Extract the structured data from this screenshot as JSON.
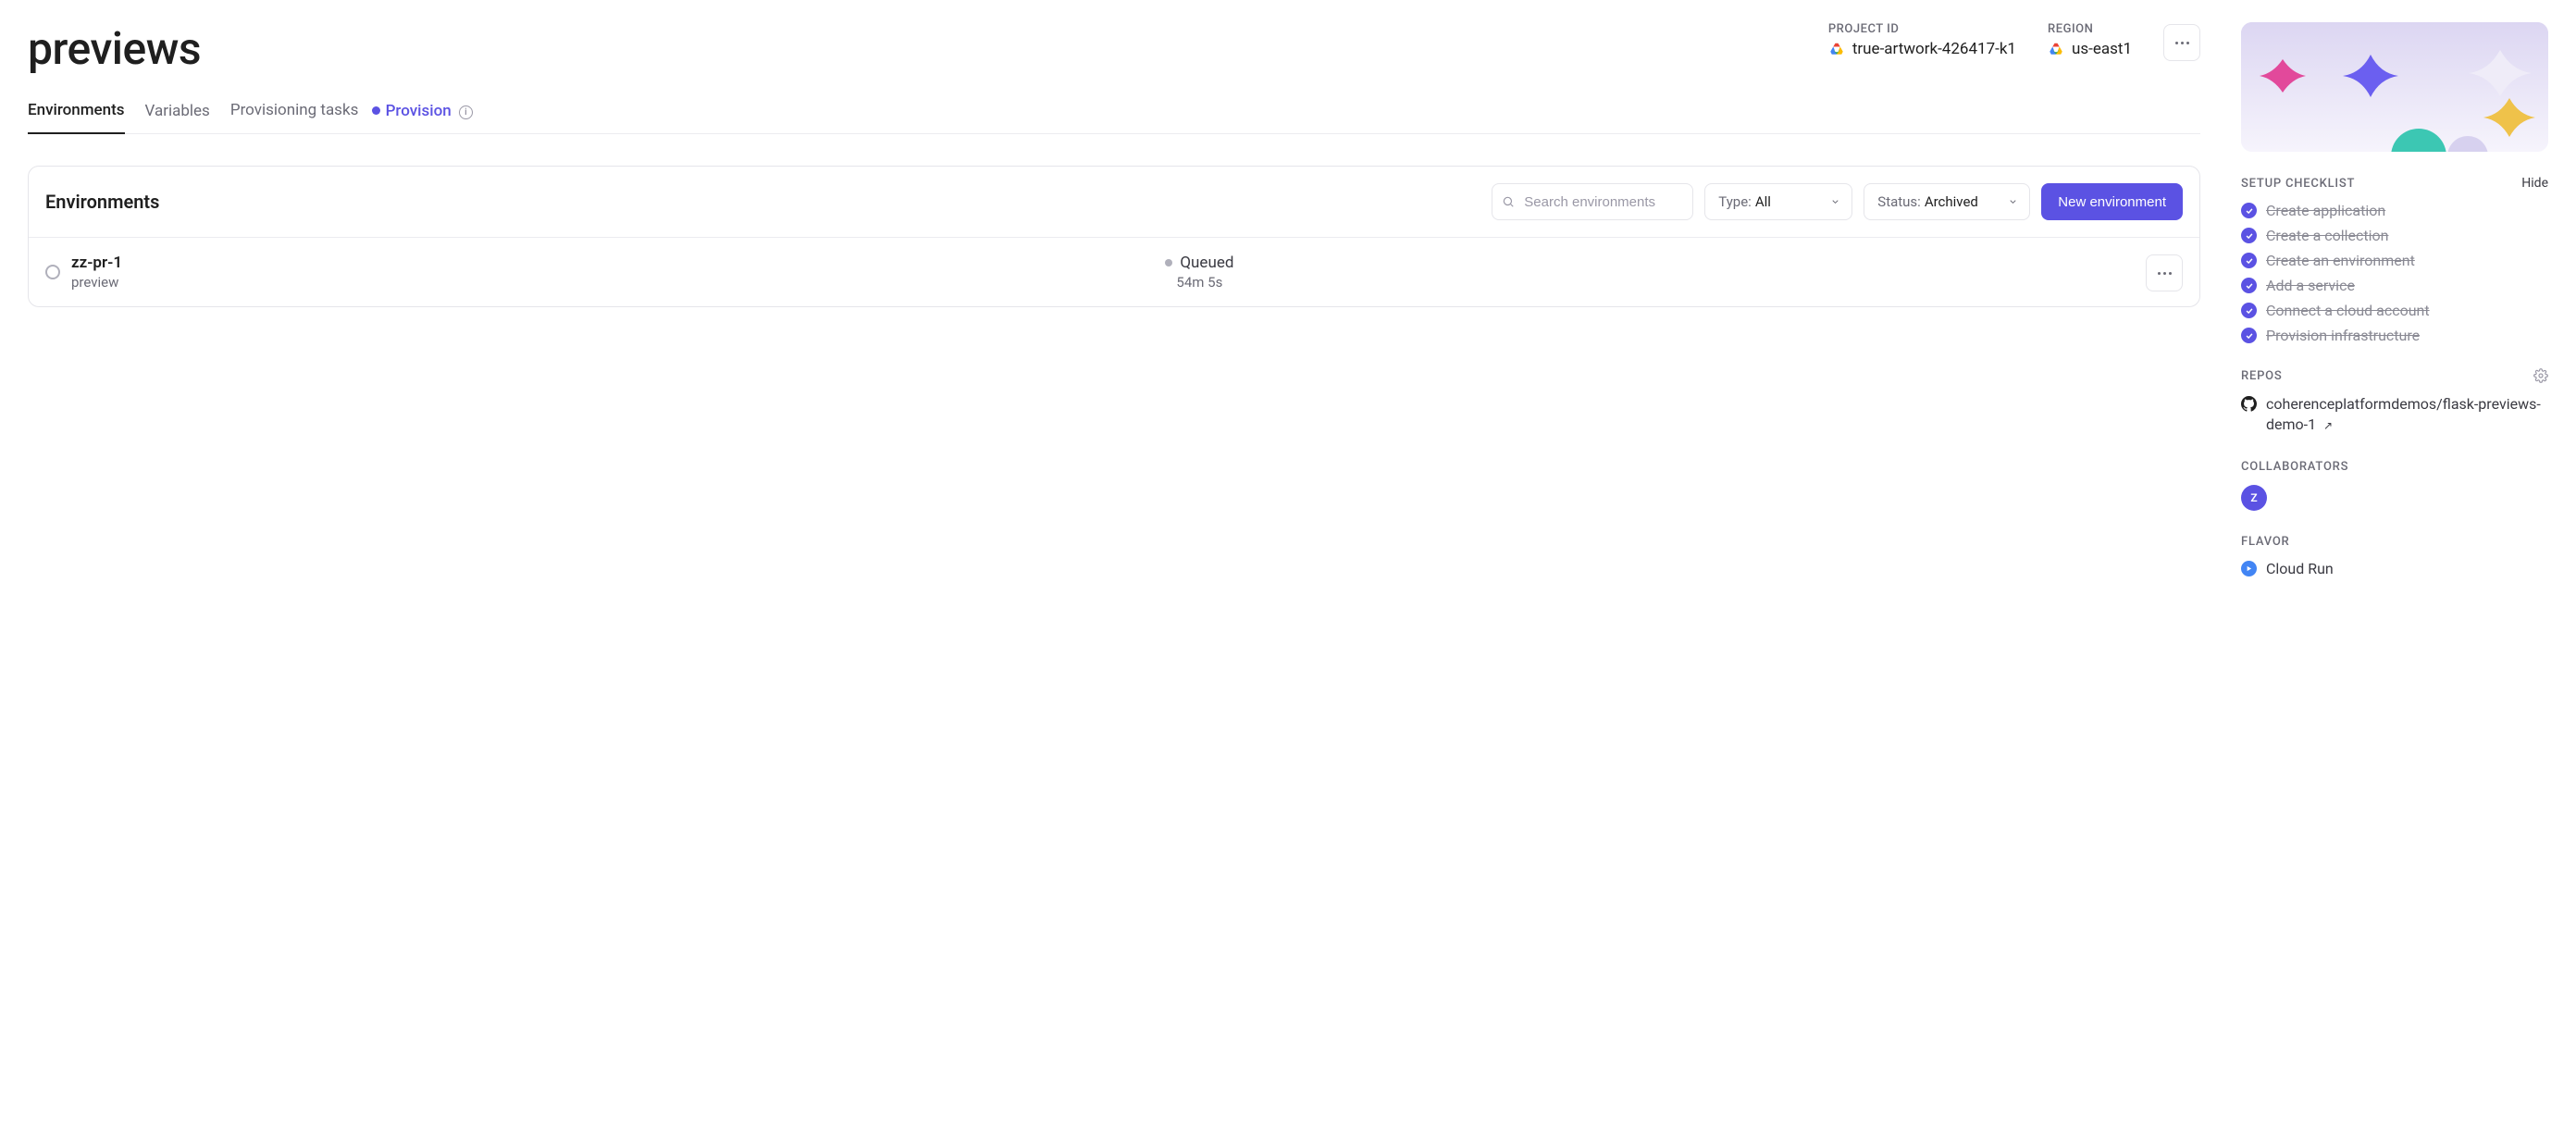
{
  "page": {
    "title": "previews"
  },
  "header": {
    "project_id_label": "PROJECT ID",
    "project_id": "true-artwork-426417-k1",
    "region_label": "REGION",
    "region": "us-east1"
  },
  "tabs": {
    "environments": "Environments",
    "variables": "Variables",
    "provisioning_tasks": "Provisioning tasks",
    "provision_badge": "Provision"
  },
  "env_panel": {
    "title": "Environments",
    "search_placeholder": "Search environments",
    "type_label": "Type:",
    "type_value": "All",
    "status_label": "Status:",
    "status_value": "Archived",
    "new_button": "New environment"
  },
  "env_rows": [
    {
      "name": "zz-pr-1",
      "kind": "preview",
      "status": "Queued",
      "age": "54m 5s"
    }
  ],
  "sidebar": {
    "checklist_label": "SETUP CHECKLIST",
    "hide": "Hide",
    "checklist": [
      "Create application",
      "Create a collection",
      "Create an environment",
      "Add a service",
      "Connect a cloud account",
      "Provision infrastructure"
    ],
    "repos_label": "REPOS",
    "repo": "coherenceplatformdemos/flask-previews-demo-1",
    "collaborators_label": "COLLABORATORS",
    "collaborator_initial": "z",
    "flavor_label": "FLAVOR",
    "flavor": "Cloud Run"
  }
}
